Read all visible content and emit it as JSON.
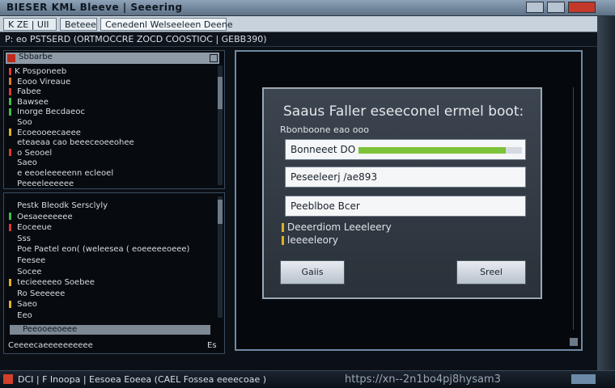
{
  "window": {
    "title": "BIESER KML Bleeve | Seeering"
  },
  "tabs": [
    {
      "label": "K ZE  |  UII"
    },
    {
      "label": "Beteee"
    },
    {
      "label": "Cenedenl Welseeleen Deene"
    }
  ],
  "toolbar": {
    "text": "P: eo   PSTSERD  (ORTMOCCRE   ZOCD  COOSTIOC  |  GEBB390)"
  },
  "tree_panel": {
    "header": "Sbbarbe",
    "rows": [
      {
        "marker": "red",
        "text": "K  Posponeeb"
      },
      {
        "marker": "org",
        "text": "  Eooo Vireaue"
      },
      {
        "marker": "red",
        "text": "    Fabee"
      },
      {
        "marker": "grn",
        "text": "      Bawsee"
      },
      {
        "marker": "grn",
        "text": "    Inorge    Becdaeoc"
      },
      {
        "marker": "none",
        "text": "      Soo"
      },
      {
        "marker": "yel",
        "text": "  Ecoeooeecaeee"
      },
      {
        "marker": "none",
        "text": "      eteaeaa cao beeeceoeeohee"
      },
      {
        "marker": "red",
        "text": "  o Seooel"
      },
      {
        "marker": "none",
        "text": "    Saeo"
      },
      {
        "marker": "none",
        "text": "    e eeoeleeeeenn  ecleoel"
      },
      {
        "marker": "none",
        "text": "  Peeeeleeeeee"
      }
    ]
  },
  "detail_panel": {
    "rows": [
      {
        "marker": "none",
        "text": "  Pestk Bleodk Sersclyly"
      },
      {
        "marker": "grn",
        "text": "  Oesaeeeeeee"
      },
      {
        "marker": "red",
        "text": "  Eoceeue"
      },
      {
        "marker": "none",
        "text": "  Sss"
      },
      {
        "marker": "none",
        "text": "  Poe  Paetel eon( (weleesea ( eoeeeeeoeee)"
      },
      {
        "marker": "none",
        "text": "  Feesee"
      },
      {
        "marker": "none",
        "text": "  Socee"
      },
      {
        "marker": "yel",
        "text": "  tecieeeeeo  Soebee"
      },
      {
        "marker": "none",
        "text": "  Ro  Seeeeee"
      },
      {
        "marker": "yel",
        "text": "  Saeo"
      },
      {
        "marker": "none",
        "text": "  Eeo"
      }
    ],
    "scroll_label": "Peeooeeoeee",
    "status_left": "Ceeeecaeeeeeeeeee",
    "status_right": "Es"
  },
  "dialog": {
    "title": "Saaus Faller eseeconel ermel boot:",
    "subtitle": "Rbonboone eao ooo",
    "progress_label": "Bonneeet DO",
    "progress": 0.9,
    "field2_value": "Peseeleerj /ae893",
    "field3_value": "Peeblboe Bcer",
    "option1": "Deeerdiom Leeeleery",
    "option2": "leeeeleory",
    "btn_left": "Gaiis",
    "btn_right": "Sreel"
  },
  "taskbar": {
    "text": "DCI  |  F Inoopa  | Eesoea  Eoeea  (CAEL  Fossea  eeeecoae )",
    "url": "https://xn--2n1bo4pj8hysam3"
  }
}
